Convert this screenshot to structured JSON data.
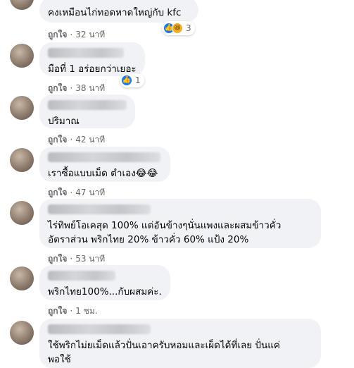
{
  "comments": [
    {
      "text": "คงเหมือนไก่ทอดหาดใหญ่กับ kfc",
      "like_label": "ถูกใจ",
      "time": "32 นาที",
      "reaction_count": "3"
    },
    {
      "text": "มือที่ 1 อร่อยกว่าเยอะ",
      "like_label": "ถูกใจ",
      "time": "38 นาที",
      "reaction_count": "1"
    },
    {
      "text": "ปริมาณ",
      "like_label": "ถูกใจ",
      "time": "42 นาที"
    },
    {
      "text": "เราซื้อแบบเม็ด ตำเอง😂😂",
      "like_label": "ถูกใจ",
      "time": "47 นาที"
    },
    {
      "text": "ไร่ทิพย์โอเคสุด 100% แต่อันข้างๆนั่นแพงและผสมข้าวคั่ว\nอัตราส่วน พริกไทย 20% ข้าวคั่ว 60% แป้ง 20%",
      "like_label": "ถูกใจ",
      "time": "53 นาที"
    },
    {
      "text": "พริกไทย100%...กับผสมค่ะ.",
      "like_label": "ถูกใจ",
      "time": "1 ชม."
    },
    {
      "text": "ใช้พริกไม่ยเม็ดแล้วปั่นเอาครับหอมและเผ็ดได้ที่เลย ปั่นแค่\nพอใช้"
    }
  ],
  "separator": "·",
  "colors": {
    "bubble": "#f0f2f5",
    "meta": "#65676b",
    "like_reaction": "#1877f2",
    "haha_reaction": "#f7b125"
  },
  "icons": [
    "like-reaction-icon",
    "haha-reaction-icon"
  ]
}
